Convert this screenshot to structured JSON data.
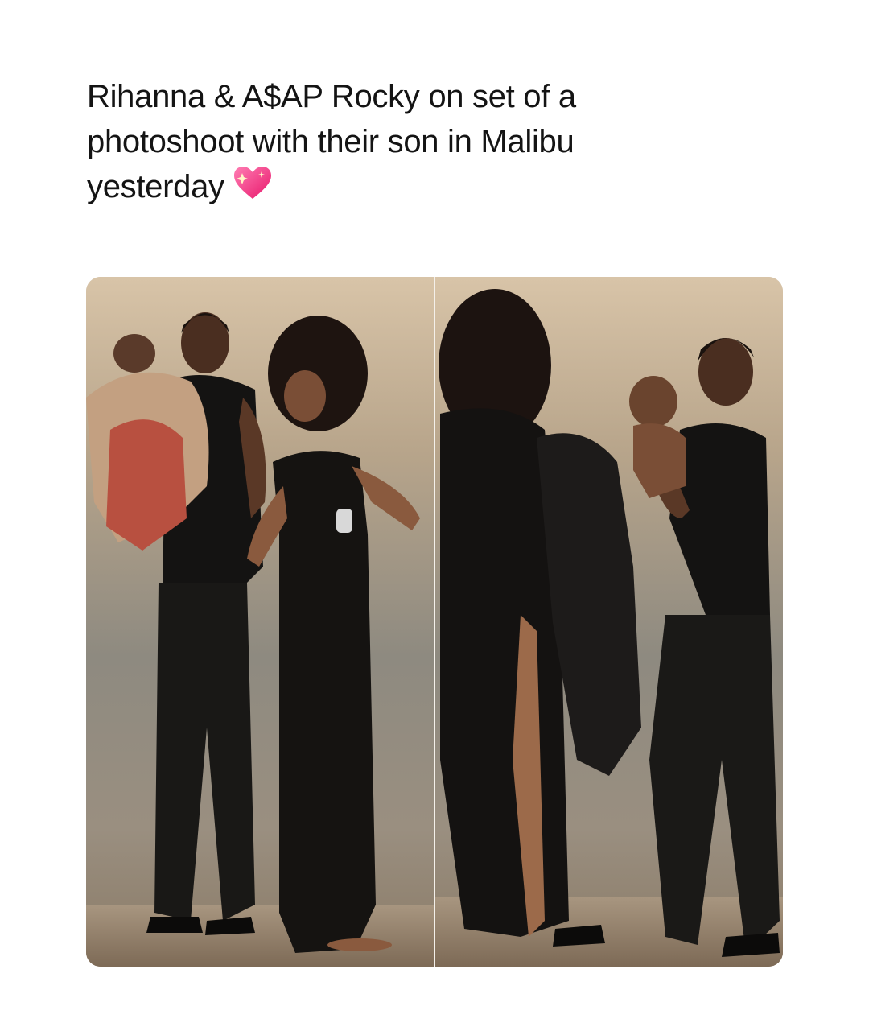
{
  "post": {
    "caption_lines": [
      "Rihanna & A$AP Rocky on set of a",
      "photoshoot with their son in Malibu",
      "yesterday"
    ],
    "emoji": "sparkling-heart-icon"
  },
  "colors": {
    "background": "#ffffff",
    "text": "#141414",
    "heart": "#ff3f8e"
  }
}
